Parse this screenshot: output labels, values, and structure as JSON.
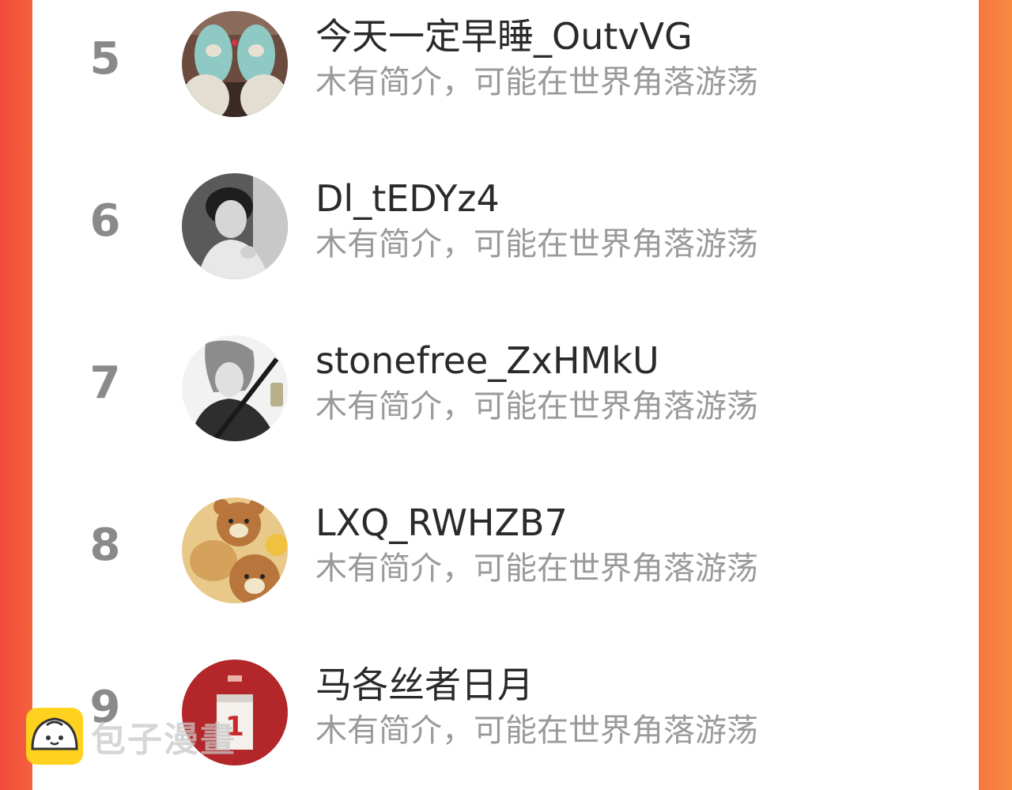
{
  "list": [
    {
      "rank": "5",
      "name": "今天一定早睡_OutvVG",
      "desc": "木有简介，可能在世界角落游荡",
      "avatar_icon": "feet-slippers-avatar"
    },
    {
      "rank": "6",
      "name": "Dl_tEDYz4",
      "desc": "木有简介，可能在世界角落游荡",
      "avatar_icon": "person-photo-avatar"
    },
    {
      "rank": "7",
      "name": "stonefree_ZxHMkU",
      "desc": "木有简介，可能在世界角落游荡",
      "avatar_icon": "anime-character-avatar"
    },
    {
      "rank": "8",
      "name": "LXQ_RWHZB7",
      "desc": "木有简介，可能在世界角落游荡",
      "avatar_icon": "bear-plush-avatar"
    },
    {
      "rank": "9",
      "name": "马各丝者日月",
      "desc": "木有简介，可能在世界角落游荡",
      "avatar_icon": "red-calendar-avatar"
    }
  ],
  "watermark": {
    "text": "包子漫畫",
    "icon": "bun-logo-icon"
  },
  "colors": {
    "background_left": "#f24a3c",
    "background_right": "#f98a3f",
    "panel": "#ffffff",
    "rank": "#8a8a8a",
    "name": "#2a2a2a",
    "desc": "#9a9a9a"
  }
}
